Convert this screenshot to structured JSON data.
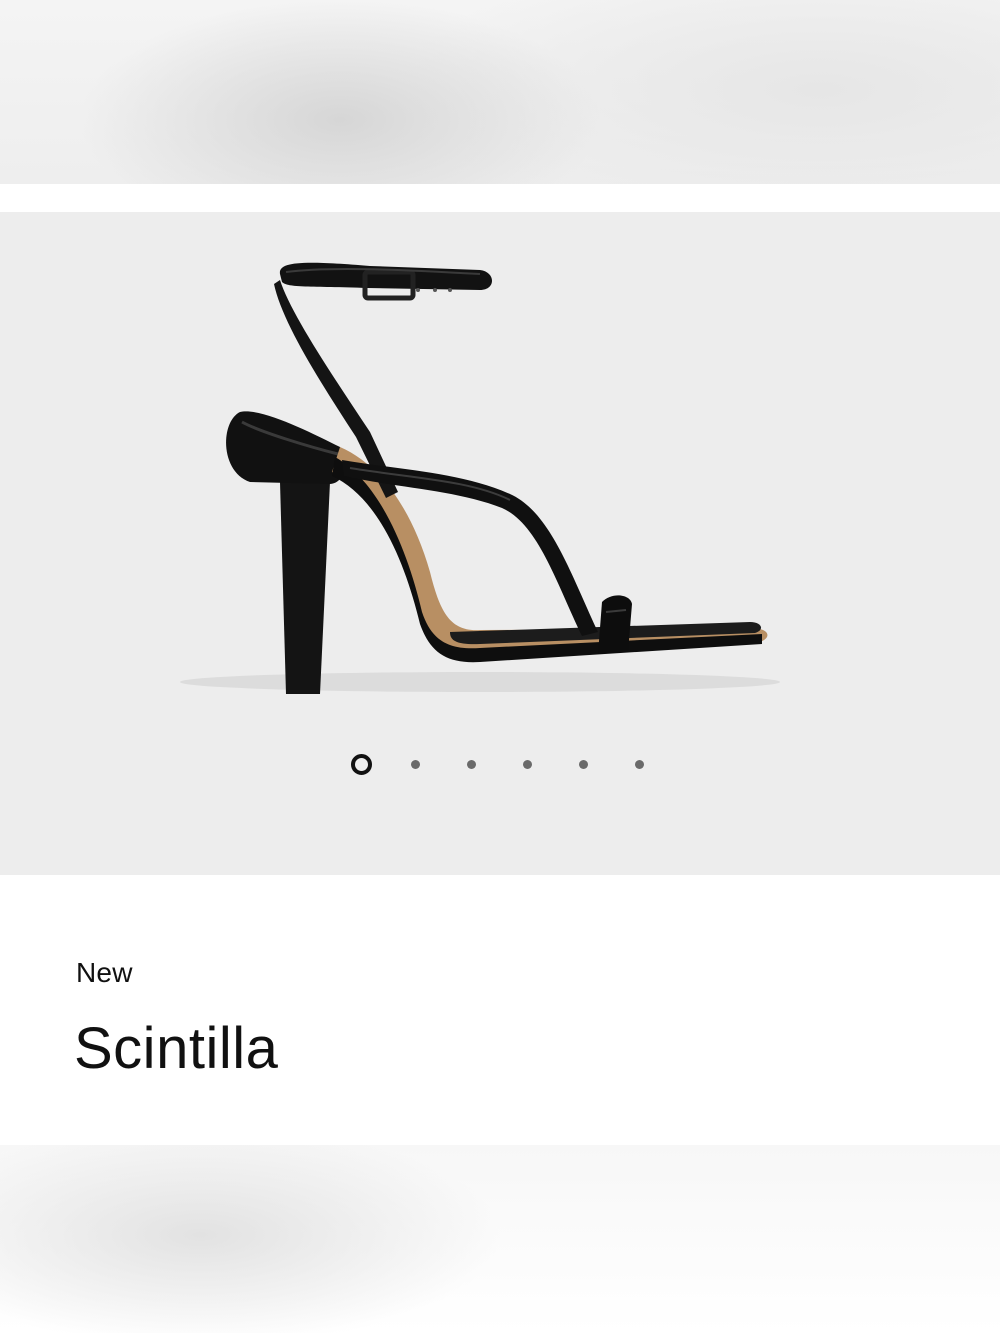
{
  "product": {
    "badge": "New",
    "name": "Scintilla"
  },
  "gallery": {
    "image_name": "black-strappy-heeled-sandal",
    "slide_count": 6,
    "active_slide": 1
  },
  "colors": {
    "gallery_bg": "#ededed",
    "text": "#111111",
    "dot": "#6a6a6a"
  }
}
